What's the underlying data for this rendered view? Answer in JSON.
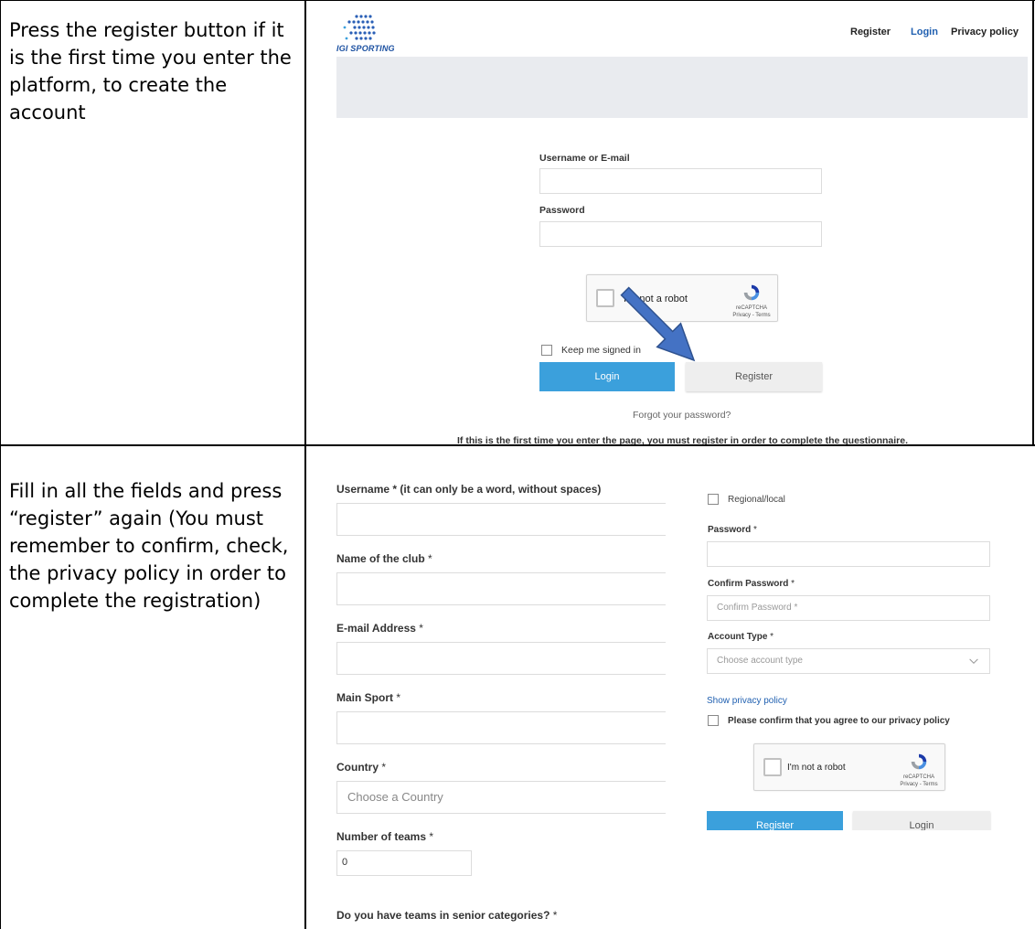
{
  "instructions": {
    "step1": "Press the register button if it is the first time you enter the platform, to create the account",
    "step2": "Fill in all the fields and press “register” again (You must remember to confirm, check, the privacy policy in order to complete the registration)"
  },
  "login_page": {
    "logo_text": "IGI SPORTING",
    "nav": {
      "register": "Register",
      "login": "Login",
      "privacy": "Privacy policy"
    },
    "username_label": "Username or E-mail",
    "password_label": "Password",
    "captcha_label": "I'm not a robot",
    "captcha_brand": "reCAPTCHA",
    "captcha_links": "Privacy - Terms",
    "keep_signed_in": "Keep me signed in",
    "login_button": "Login",
    "register_button": "Register",
    "forgot_password": "Forgot your password?",
    "first_time_note": "If this is the first time you enter the page, you must register in order to complete the questionnaire."
  },
  "register_form_left": {
    "username_label": "Username",
    "username_hint": " * (it can only be a word, without spaces)",
    "club_label": "Name of the club",
    "email_label": "E-mail Address",
    "sport_label": "Main Sport",
    "country_label": "Country",
    "country_placeholder": "Choose a Country",
    "teams_label": "Number of teams",
    "teams_value": "0",
    "senior_label": "Do you have teams in senior categories?",
    "required_mark": " *"
  },
  "register_form_right": {
    "regional_label": "Regional/local",
    "password_label": "Password",
    "confirm_label": "Confirm Password",
    "confirm_placeholder": "Confirm Password *",
    "account_type_label": "Account Type",
    "account_type_placeholder": "Choose account type",
    "show_privacy": "Show privacy policy",
    "privacy_confirm": "Please confirm that you agree to our privacy policy",
    "captcha_label": "I'm not a robot",
    "captcha_brand": "reCAPTCHA",
    "captcha_links": "Privacy - Terms",
    "register_button": "Register",
    "login_button": "Login",
    "required_mark": " *"
  },
  "colors": {
    "accent_blue": "#3ba0dc",
    "link_blue": "#1f5fb0",
    "arrow_fill": "#4472c4",
    "arrow_stroke": "#2f528f"
  }
}
